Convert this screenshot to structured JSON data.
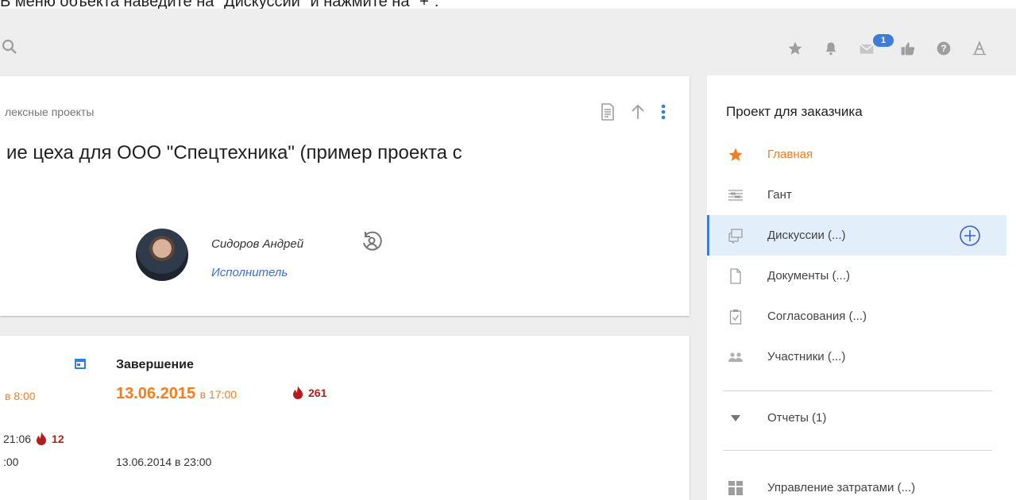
{
  "instruction": "В меню объекта наведите на \"Дискуссии\" и нажмите на \"+\".",
  "topbar": {
    "icons": [
      "search-icon",
      "star-icon",
      "bell-icon",
      "mail-icon",
      "thumbs-up-icon",
      "help-icon",
      "font-icon"
    ],
    "mail_badge": "1",
    "badge_color": "#3f7bd9"
  },
  "project": {
    "breadcrumb": "лексные проекты",
    "title": "ие цеха для ООО \"Спецтехника\" (пример проекта с",
    "person_name": "Сидоров Андрей",
    "person_role": "Исполнитель"
  },
  "schedule": {
    "start_time": "в 8:00",
    "end_label": "Завершение",
    "end_date": "13.06.2015",
    "end_time": "в 17:00",
    "end_overdue": "261",
    "row2_time": "21:06",
    "row2_overdue": "12",
    "row3_left": ":00",
    "row3_mid": "13.06.2014 в 23:00",
    "accent_color": "#f57c1f",
    "overdue_color": "#b71c1c"
  },
  "sidebar": {
    "title": "Проект для заказчика",
    "items": [
      {
        "label": "Главная",
        "icon": "star-icon"
      },
      {
        "label": "Гант",
        "icon": "gantt-icon"
      },
      {
        "label": "Дискуссии (...)",
        "icon": "discussion-icon"
      },
      {
        "label": "Документы (...)",
        "icon": "document-icon"
      },
      {
        "label": "Согласования (...)",
        "icon": "approval-icon"
      },
      {
        "label": "Участники (...)",
        "icon": "people-icon"
      },
      {
        "label": "Отчеты (1)",
        "icon": "triangle-down-icon"
      },
      {
        "label": "Управление затратами (...)",
        "icon": "cost-icon"
      }
    ]
  }
}
